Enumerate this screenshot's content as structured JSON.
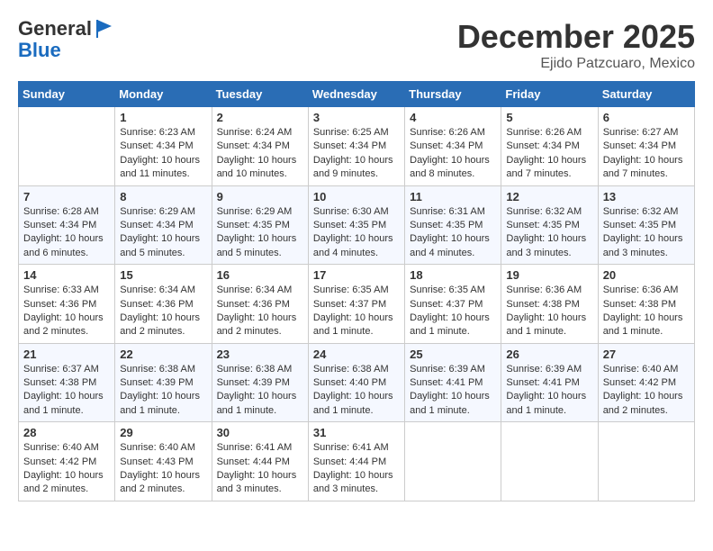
{
  "header": {
    "logo_general": "General",
    "logo_blue": "Blue",
    "month_title": "December 2025",
    "location": "Ejido Patzcuaro, Mexico"
  },
  "days_of_week": [
    "Sunday",
    "Monday",
    "Tuesday",
    "Wednesday",
    "Thursday",
    "Friday",
    "Saturday"
  ],
  "weeks": [
    [
      {
        "day": "",
        "info": ""
      },
      {
        "day": "1",
        "info": "Sunrise: 6:23 AM\nSunset: 4:34 PM\nDaylight: 10 hours and 11 minutes."
      },
      {
        "day": "2",
        "info": "Sunrise: 6:24 AM\nSunset: 4:34 PM\nDaylight: 10 hours and 10 minutes."
      },
      {
        "day": "3",
        "info": "Sunrise: 6:25 AM\nSunset: 4:34 PM\nDaylight: 10 hours and 9 minutes."
      },
      {
        "day": "4",
        "info": "Sunrise: 6:26 AM\nSunset: 4:34 PM\nDaylight: 10 hours and 8 minutes."
      },
      {
        "day": "5",
        "info": "Sunrise: 6:26 AM\nSunset: 4:34 PM\nDaylight: 10 hours and 7 minutes."
      },
      {
        "day": "6",
        "info": "Sunrise: 6:27 AM\nSunset: 4:34 PM\nDaylight: 10 hours and 7 minutes."
      }
    ],
    [
      {
        "day": "7",
        "info": "Sunrise: 6:28 AM\nSunset: 4:34 PM\nDaylight: 10 hours and 6 minutes."
      },
      {
        "day": "8",
        "info": "Sunrise: 6:29 AM\nSunset: 4:34 PM\nDaylight: 10 hours and 5 minutes."
      },
      {
        "day": "9",
        "info": "Sunrise: 6:29 AM\nSunset: 4:35 PM\nDaylight: 10 hours and 5 minutes."
      },
      {
        "day": "10",
        "info": "Sunrise: 6:30 AM\nSunset: 4:35 PM\nDaylight: 10 hours and 4 minutes."
      },
      {
        "day": "11",
        "info": "Sunrise: 6:31 AM\nSunset: 4:35 PM\nDaylight: 10 hours and 4 minutes."
      },
      {
        "day": "12",
        "info": "Sunrise: 6:32 AM\nSunset: 4:35 PM\nDaylight: 10 hours and 3 minutes."
      },
      {
        "day": "13",
        "info": "Sunrise: 6:32 AM\nSunset: 4:35 PM\nDaylight: 10 hours and 3 minutes."
      }
    ],
    [
      {
        "day": "14",
        "info": "Sunrise: 6:33 AM\nSunset: 4:36 PM\nDaylight: 10 hours and 2 minutes."
      },
      {
        "day": "15",
        "info": "Sunrise: 6:34 AM\nSunset: 4:36 PM\nDaylight: 10 hours and 2 minutes."
      },
      {
        "day": "16",
        "info": "Sunrise: 6:34 AM\nSunset: 4:36 PM\nDaylight: 10 hours and 2 minutes."
      },
      {
        "day": "17",
        "info": "Sunrise: 6:35 AM\nSunset: 4:37 PM\nDaylight: 10 hours and 1 minute."
      },
      {
        "day": "18",
        "info": "Sunrise: 6:35 AM\nSunset: 4:37 PM\nDaylight: 10 hours and 1 minute."
      },
      {
        "day": "19",
        "info": "Sunrise: 6:36 AM\nSunset: 4:38 PM\nDaylight: 10 hours and 1 minute."
      },
      {
        "day": "20",
        "info": "Sunrise: 6:36 AM\nSunset: 4:38 PM\nDaylight: 10 hours and 1 minute."
      }
    ],
    [
      {
        "day": "21",
        "info": "Sunrise: 6:37 AM\nSunset: 4:38 PM\nDaylight: 10 hours and 1 minute."
      },
      {
        "day": "22",
        "info": "Sunrise: 6:38 AM\nSunset: 4:39 PM\nDaylight: 10 hours and 1 minute."
      },
      {
        "day": "23",
        "info": "Sunrise: 6:38 AM\nSunset: 4:39 PM\nDaylight: 10 hours and 1 minute."
      },
      {
        "day": "24",
        "info": "Sunrise: 6:38 AM\nSunset: 4:40 PM\nDaylight: 10 hours and 1 minute."
      },
      {
        "day": "25",
        "info": "Sunrise: 6:39 AM\nSunset: 4:41 PM\nDaylight: 10 hours and 1 minute."
      },
      {
        "day": "26",
        "info": "Sunrise: 6:39 AM\nSunset: 4:41 PM\nDaylight: 10 hours and 1 minute."
      },
      {
        "day": "27",
        "info": "Sunrise: 6:40 AM\nSunset: 4:42 PM\nDaylight: 10 hours and 2 minutes."
      }
    ],
    [
      {
        "day": "28",
        "info": "Sunrise: 6:40 AM\nSunset: 4:42 PM\nDaylight: 10 hours and 2 minutes."
      },
      {
        "day": "29",
        "info": "Sunrise: 6:40 AM\nSunset: 4:43 PM\nDaylight: 10 hours and 2 minutes."
      },
      {
        "day": "30",
        "info": "Sunrise: 6:41 AM\nSunset: 4:44 PM\nDaylight: 10 hours and 3 minutes."
      },
      {
        "day": "31",
        "info": "Sunrise: 6:41 AM\nSunset: 4:44 PM\nDaylight: 10 hours and 3 minutes."
      },
      {
        "day": "",
        "info": ""
      },
      {
        "day": "",
        "info": ""
      },
      {
        "day": "",
        "info": ""
      }
    ]
  ]
}
